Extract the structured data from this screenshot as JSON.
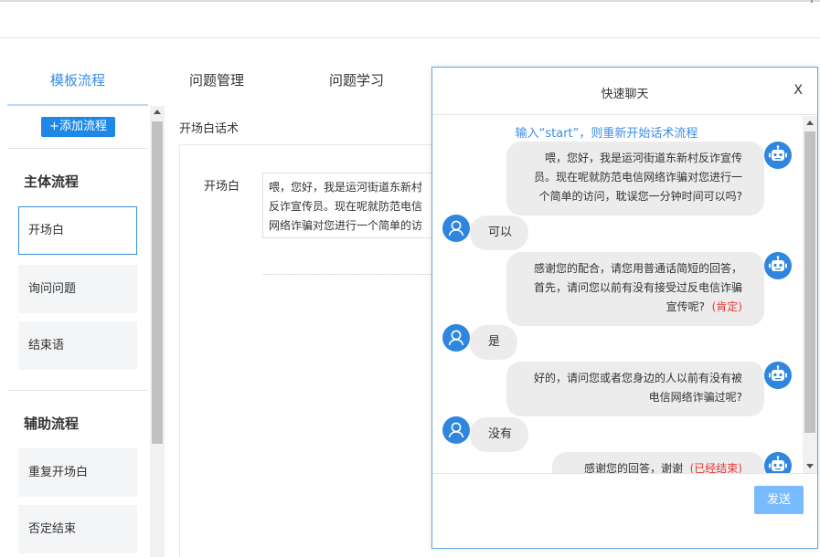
{
  "tabs": [
    {
      "label": "模板流程"
    },
    {
      "label": "问题管理"
    },
    {
      "label": "问题学习"
    }
  ],
  "sidebar": {
    "add_label": "+添加流程",
    "main_title": "主体流程",
    "main_items": [
      {
        "label": "开场白"
      },
      {
        "label": "询问问题"
      },
      {
        "label": "结束语"
      }
    ],
    "aux_title": "辅助流程",
    "aux_items": [
      {
        "label": "重复开场白"
      },
      {
        "label": "否定结束"
      }
    ]
  },
  "content": {
    "header": "开场白话术",
    "field_label": "开场白",
    "field_value": "喂，您好，我是运河街道东新村反诈宣传员。现在呢就防范电信网络诈骗对您进行一个简单的访"
  },
  "chat": {
    "title": "快速聊天",
    "close_label": "X",
    "hint": "输入“start”，则重新开始话术流程",
    "messages": [
      {
        "role": "bot",
        "text": "喂，您好，我是运河街道东新村反诈宣传员。现在呢就防范电信网络诈骗对您进行一个简单的访问，耽误您一分钟时间可以吗?"
      },
      {
        "role": "user",
        "text": "可以"
      },
      {
        "role": "bot",
        "text": "感谢您的配合，请您用普通话简短的回答，首先，请问您以前有没有接受过反电信诈骗宣传呢?",
        "tag": "(肯定)"
      },
      {
        "role": "user",
        "text": "是"
      },
      {
        "role": "bot",
        "text": "好的，请问您或者您身边的人以前有没有被电信网络诈骗过呢?"
      },
      {
        "role": "user",
        "text": "没有"
      },
      {
        "role": "bot",
        "text": "感谢您的回答，谢谢",
        "tag": "(已经结束)"
      }
    ],
    "send_label": "发送"
  },
  "colors": {
    "accent": "#3a8ee6",
    "button": "#1e88e5",
    "send_button": "#79bbff",
    "avatar": "#2f86de",
    "bubble": "#ececec",
    "tag": "#e53935"
  },
  "icons": {
    "bot": "robot-icon",
    "user": "user-icon"
  }
}
